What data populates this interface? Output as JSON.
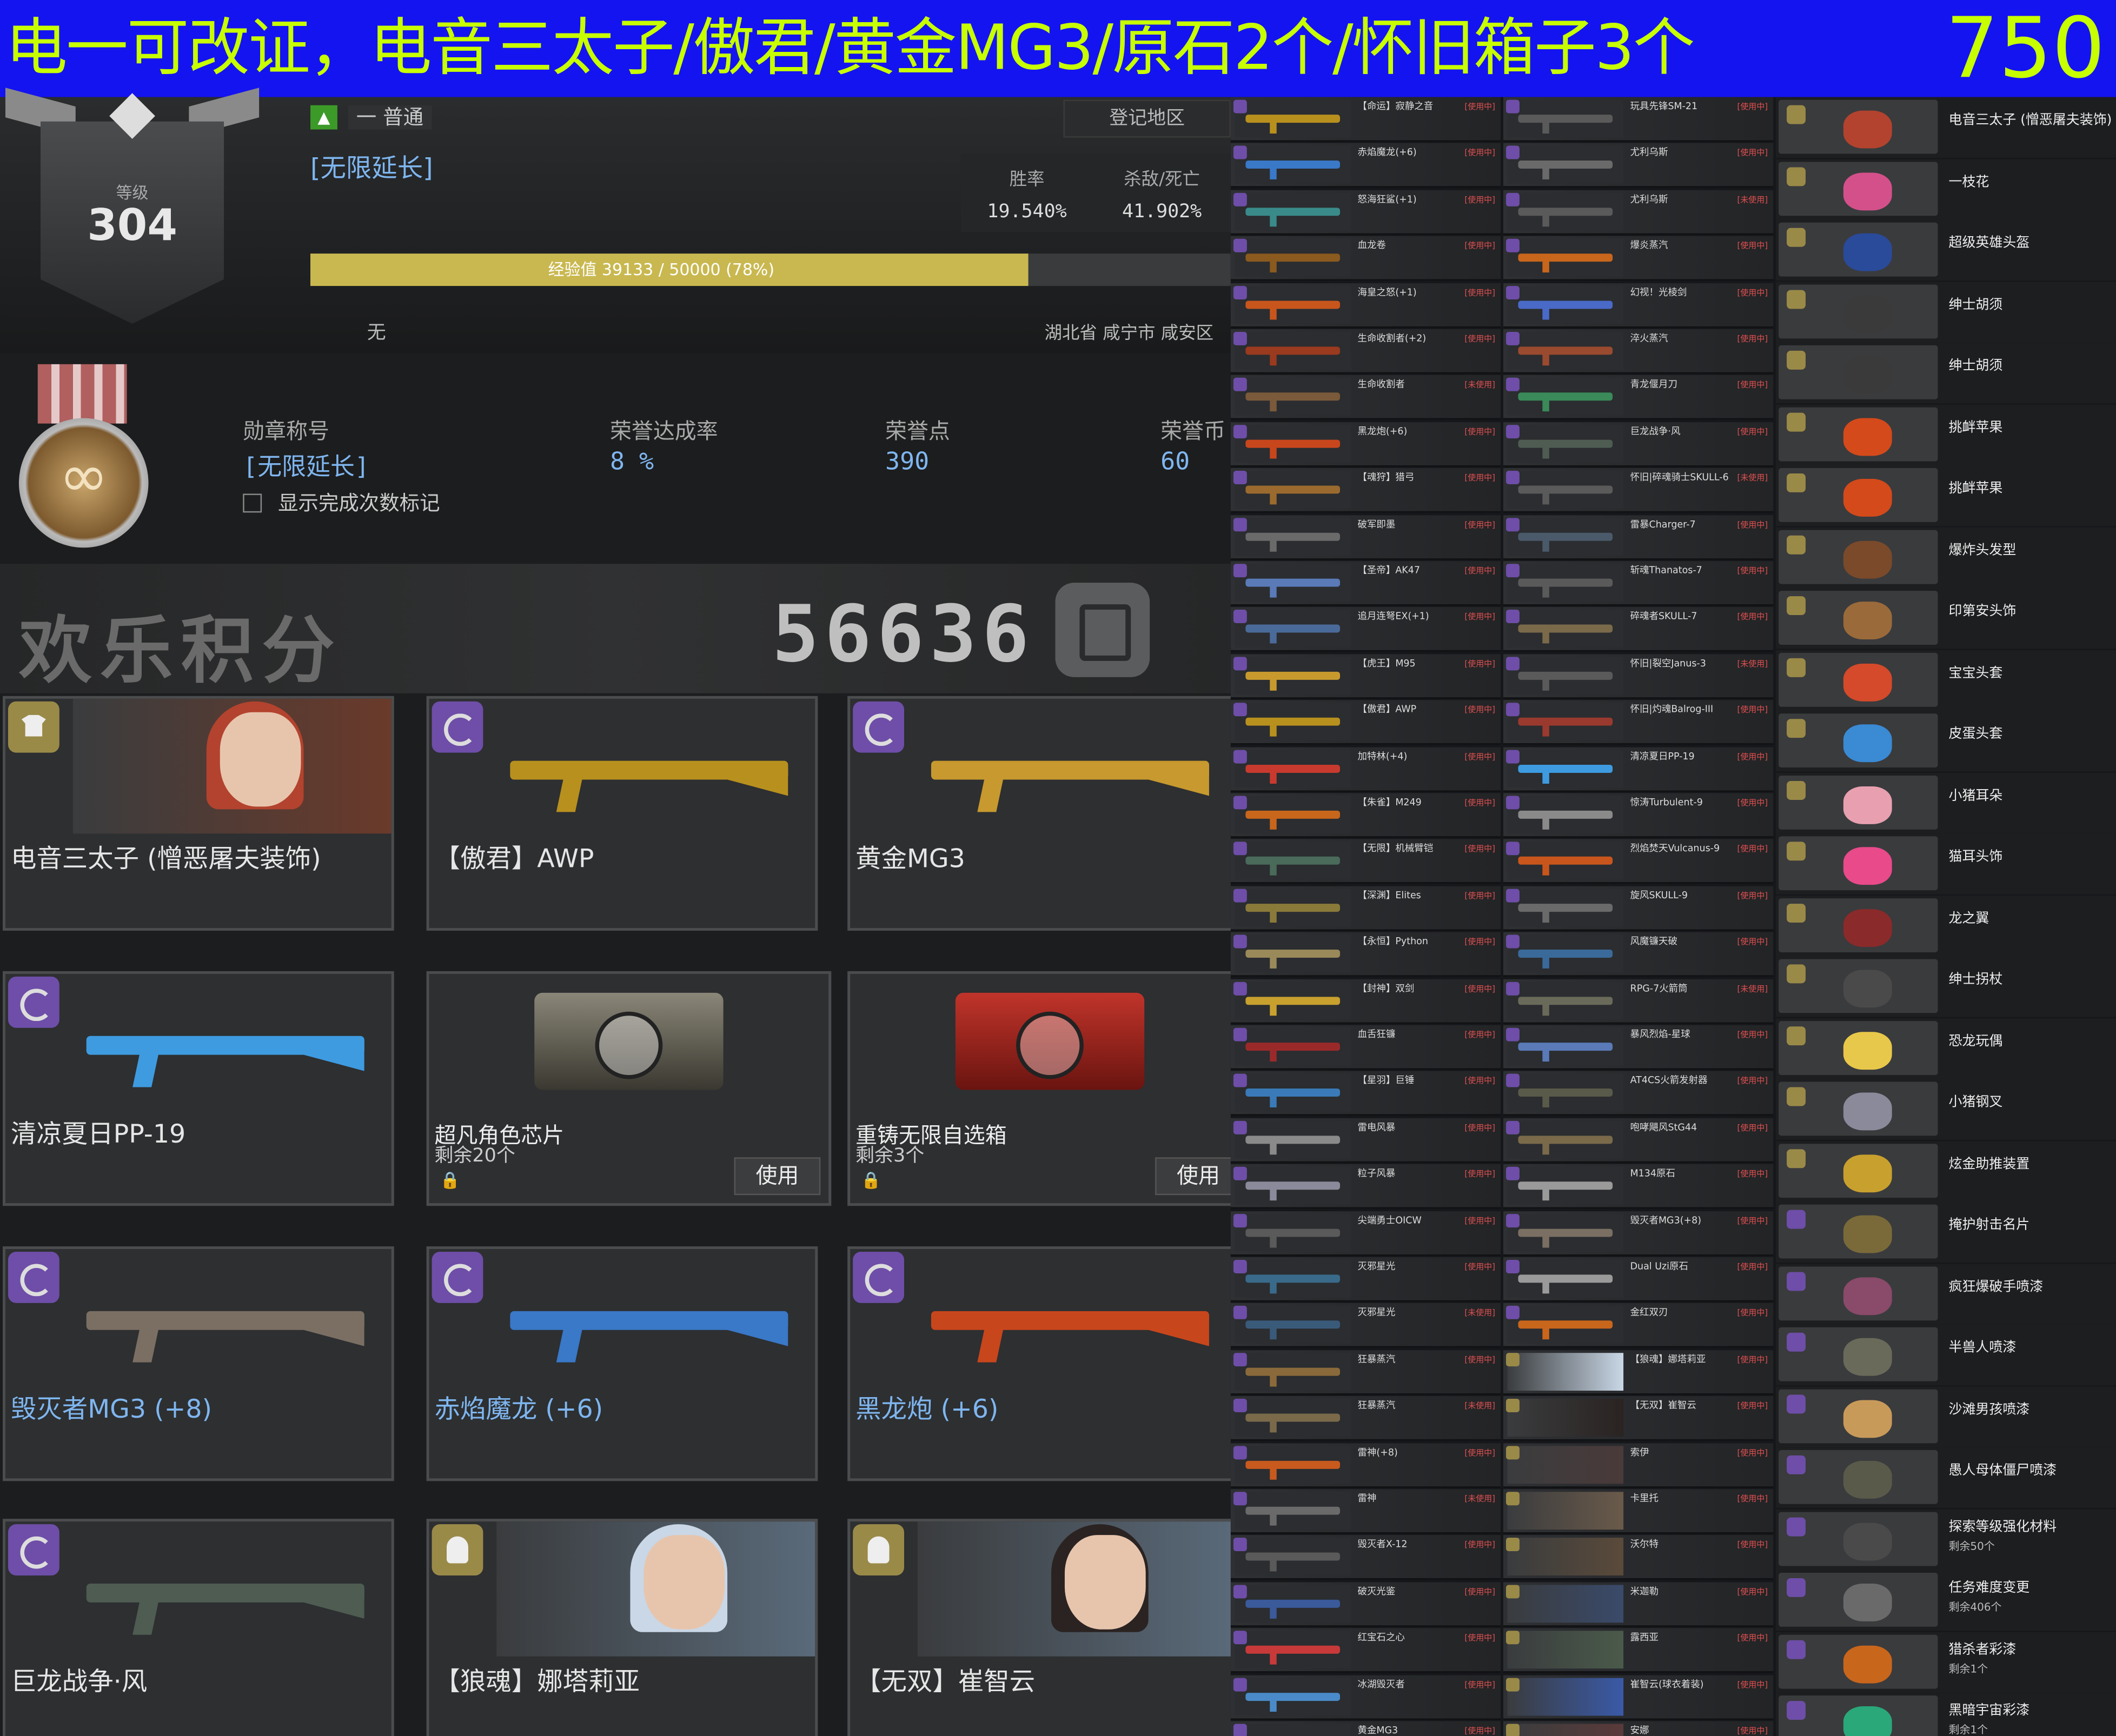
{
  "banner": {
    "title": "电一可改证，电音三太子/傲君/黄金MG3/原石2个/怀旧箱子3个",
    "price": "750"
  },
  "profile": {
    "level_label": "等级",
    "level": "304",
    "rank": "一 普通",
    "region_button": "登记地区",
    "title": "[无限延长]",
    "win_rate_label": "胜率",
    "win_rate": "19.540%",
    "kd_label": "杀敌/死亡",
    "kd": "41.902%",
    "xp_text": "经验值 39133 / 50000 (78%)",
    "xp_percent": 78,
    "clan": "无",
    "location": "湖北省 咸宁市 咸安区"
  },
  "medal": {
    "title_label": "勋章称号",
    "title_value": "[无限延长]",
    "honor_rate_label": "荣誉达成率",
    "honor_rate": "8 %",
    "honor_points_label": "荣誉点",
    "honor_points": "390",
    "honor_coins_label": "荣誉币",
    "honor_coins": "60",
    "show_count_label": "显示完成次数标记"
  },
  "score": {
    "label": "欢乐积分",
    "value": "56636"
  },
  "featured": [
    {
      "name": "电音三太子 (憎恶屠夫装饰)",
      "type": "cosmetic",
      "color": "#b3432e"
    },
    {
      "name": "【傲君】AWP",
      "type": "weapon",
      "color": "#b8901e"
    },
    {
      "name": "黄金MG3",
      "type": "weapon",
      "color": "#c7992e"
    },
    {
      "name": "清凉夏日PP-19",
      "type": "weapon",
      "color": "#3e9be0"
    },
    {
      "name": "超凡角色芯片",
      "sub": "剩余20个",
      "button": "使用",
      "type": "chip",
      "color": "#6e6a5c"
    },
    {
      "name": "重铸无限自选箱",
      "sub": "剩余3个",
      "button": "使用",
      "type": "box",
      "color": "#8e1c16"
    },
    {
      "name": "毁灭者MG3 (+8)",
      "type": "weapon",
      "color": "#7b6f63"
    },
    {
      "name": "赤焰魔龙 (+6)",
      "type": "weapon",
      "color": "#3a78c8"
    },
    {
      "name": "黑龙炮 (+6)",
      "type": "weapon",
      "color": "#c8461c"
    },
    {
      "name": "巨龙战争·风",
      "type": "weapon",
      "color": "#4e5c52"
    },
    {
      "name": "【狼魂】娜塔莉亚",
      "type": "character",
      "color": "#c9d7e6"
    },
    {
      "name": "【无双】崔智云",
      "type": "character",
      "color": "#2a2322"
    }
  ],
  "inventory_col1": [
    {
      "name": "【命运】寂静之音",
      "status": "[使用中]",
      "color": "#b8901e"
    },
    {
      "name": "赤焰魔龙(+6)",
      "status": "[使用中]",
      "color": "#3a78c8"
    },
    {
      "name": "怒海狂鲨(+1)",
      "status": "[使用中]",
      "color": "#3a8a8a"
    },
    {
      "name": "血龙卷",
      "status": "[使用中]",
      "color": "#8a5a1e"
    },
    {
      "name": "海皇之怒(+1)",
      "status": "[使用中]",
      "color": "#c8561c"
    },
    {
      "name": "生命收割者(+2)",
      "status": "[使用中]",
      "color": "#9a3a1e"
    },
    {
      "name": "生命收割者",
      "status": "[未使用]",
      "color": "#7a5a3a"
    },
    {
      "name": "黑龙炮(+6)",
      "status": "[使用中]",
      "color": "#c8461c"
    },
    {
      "name": "【魂狩】猎弓",
      "status": "[使用中]",
      "color": "#9a6a2e"
    },
    {
      "name": "破军即墨",
      "status": "[使用中]",
      "color": "#6a6a6a"
    },
    {
      "name": "【圣帝】AK47",
      "status": "[使用中]",
      "color": "#5a7ab8"
    },
    {
      "name": "追月连弩EX(+1)",
      "status": "[使用中]",
      "color": "#4a6a9a"
    },
    {
      "name": "【虎王】M95",
      "status": "[使用中]",
      "color": "#c89a2e"
    },
    {
      "name": "【傲君】AWP",
      "status": "[使用中]",
      "color": "#b8901e"
    },
    {
      "name": "加特林(+4)",
      "status": "[使用中]",
      "color": "#c83a2e"
    },
    {
      "name": "【朱雀】M249",
      "status": "[使用中]",
      "color": "#c8661c"
    },
    {
      "name": "【无限】机械臂铠",
      "status": "[使用中]",
      "color": "#4a6a5a"
    },
    {
      "name": "【深渊】Elites",
      "status": "[使用中]",
      "color": "#8a7a3a"
    },
    {
      "name": "【永恒】Python",
      "status": "[使用中]",
      "color": "#9a8a5a"
    },
    {
      "name": "【封神】双剑",
      "status": "[使用中]",
      "color": "#c8a02e"
    },
    {
      "name": "血舌狂镰",
      "status": "[使用中]",
      "color": "#9a2a2a"
    },
    {
      "name": "【星羽】巨锤",
      "status": "[使用中]",
      "color": "#3a7ab8"
    },
    {
      "name": "雷电风暴",
      "status": "[使用中]",
      "color": "#8a8a8a"
    },
    {
      "name": "粒子风暴",
      "status": "[使用中]",
      "color": "#8a8a9a"
    },
    {
      "name": "尖端勇士OICW",
      "status": "[使用中]",
      "color": "#5a5a5a"
    },
    {
      "name": "灭邪星光",
      "status": "[使用中]",
      "color": "#3a6a8a"
    },
    {
      "name": "灭邪星光",
      "status": "[未使用]",
      "color": "#3a5a7a"
    },
    {
      "name": "狂暴蒸汽",
      "status": "[使用中]",
      "color": "#8a6a3a"
    },
    {
      "name": "狂暴蒸汽",
      "status": "[未使用]",
      "color": "#7a6a4a"
    },
    {
      "name": "雷神(+8)",
      "status": "[使用中]",
      "color": "#c85a1e"
    },
    {
      "name": "雷神",
      "status": "[未使用]",
      "color": "#6a6a6a"
    },
    {
      "name": "毁灭者X-12",
      "status": "[使用中]",
      "color": "#5a5a5a"
    },
    {
      "name": "破灭光鉴",
      "status": "[使用中]",
      "color": "#3a5a9a"
    },
    {
      "name": "红宝石之心",
      "status": "[使用中]",
      "color": "#c83a3a"
    },
    {
      "name": "冰湖毁灭者",
      "status": "[使用中]",
      "color": "#4a8ac8"
    },
    {
      "name": "黄金MG3",
      "status": "[使用中]",
      "color": "#c7992e"
    }
  ],
  "inventory_col2": [
    {
      "name": "玩具先锋SM-21",
      "status": "[使用中]",
      "color": "#5a5a5a"
    },
    {
      "name": "尤利乌斯",
      "status": "[使用中]",
      "color": "#6a6a6a"
    },
    {
      "name": "尤利乌斯",
      "status": "[未使用]",
      "color": "#5a5a5a"
    },
    {
      "name": "爆炎蒸汽",
      "status": "[使用中]",
      "color": "#c8661c"
    },
    {
      "name": "幻视！光棱剑",
      "status": "[使用中]",
      "color": "#4a6ac8"
    },
    {
      "name": "淬火蒸汽",
      "status": "[使用中]",
      "color": "#9a4a2e"
    },
    {
      "name": "青龙偃月刀",
      "status": "[使用中]",
      "color": "#3a8a5a"
    },
    {
      "name": "巨龙战争·风",
      "status": "[使用中]",
      "color": "#4e5c52"
    },
    {
      "name": "怀旧|碎魂骑士SKULL-6",
      "status": "[未使用]",
      "color": "#5a5a5a"
    },
    {
      "name": "雷暴Charger-7",
      "status": "[使用中]",
      "color": "#4a5a6a"
    },
    {
      "name": "斩魂Thanatos-7",
      "status": "[使用中]",
      "color": "#5a5a5a"
    },
    {
      "name": "碎魂者SKULL-7",
      "status": "[使用中]",
      "color": "#7a6a4a"
    },
    {
      "name": "怀旧|裂空Janus-3",
      "status": "[未使用]",
      "color": "#5a5a5a"
    },
    {
      "name": "怀旧|灼魂Balrog-III",
      "status": "[使用中]",
      "color": "#9a3a2e"
    },
    {
      "name": "清凉夏日PP-19",
      "status": "[使用中]",
      "color": "#3e9be0"
    },
    {
      "name": "惊涛Turbulent-9",
      "status": "[使用中]",
      "color": "#8a8a8a"
    },
    {
      "name": "烈焰焚天Vulcanus-9",
      "status": "[使用中]",
      "color": "#c8561c"
    },
    {
      "name": "旋风SKULL-9",
      "status": "[使用中]",
      "color": "#6a6a6a"
    },
    {
      "name": "风魔镰天破",
      "status": "[使用中]",
      "color": "#3a6a9a"
    },
    {
      "name": "RPG-7火箭筒",
      "status": "[未使用]",
      "color": "#6a6a5a"
    },
    {
      "name": "暴风烈焰-星球",
      "status": "[使用中]",
      "color": "#5a7ab8"
    },
    {
      "name": "AT4CS火箭发射器",
      "status": "[使用中]",
      "color": "#5a5a4a"
    },
    {
      "name": "咆哮飓风StG44",
      "status": "[使用中]",
      "color": "#7a6a4a"
    },
    {
      "name": "M134原石",
      "status": "[使用中]",
      "color": "#9a9a9a"
    },
    {
      "name": "毁灭者MG3(+8)",
      "status": "[使用中]",
      "color": "#7b6f63"
    },
    {
      "name": "Dual Uzi原石",
      "status": "[使用中]",
      "color": "#9a9a9a"
    },
    {
      "name": "金红双刃",
      "status": "[使用中]",
      "color": "#c8661c"
    },
    {
      "name": "【狼魂】娜塔莉亚",
      "status": "[使用中]",
      "color": "#c9d7e6",
      "char": true
    },
    {
      "name": "【无双】崔智云",
      "status": "[使用中]",
      "color": "#2a2322",
      "char": true
    },
    {
      "name": "索伊",
      "status": "[使用中]",
      "color": "#4a3a3a",
      "char": true
    },
    {
      "name": "卡里托",
      "status": "[使用中]",
      "color": "#6a5a4a",
      "char": true
    },
    {
      "name": "沃尔特",
      "status": "[使用中]",
      "color": "#5a4a3a",
      "char": true
    },
    {
      "name": "米迦勒",
      "status": "[使用中]",
      "color": "#3a4a6a",
      "char": true
    },
    {
      "name": "露西亚",
      "status": "[使用中]",
      "color": "#4a5a4a",
      "char": true
    },
    {
      "name": "崔智云(球衣着装)",
      "status": "[使用中]",
      "color": "#3a5aa8",
      "char": true
    },
    {
      "name": "安娜",
      "status": "[使用中]",
      "color": "#5a3a3a",
      "char": true
    }
  ],
  "inventory_col3": [
    {
      "name": "电音三太子 (憎恶屠夫装饰)",
      "color": "#b3432e"
    },
    {
      "name": "一枝花",
      "color": "#d4508a"
    },
    {
      "name": "超级英雄头盔",
      "color": "#2a4a9a"
    },
    {
      "name": "绅士胡须",
      "color": "#3a3a3a"
    },
    {
      "name": "绅士胡须",
      "color": "#3a3a3a"
    },
    {
      "name": "挑衅苹果",
      "color": "#d44a1a"
    },
    {
      "name": "挑衅苹果",
      "color": "#d44a1a"
    },
    {
      "name": "爆炸头发型",
      "color": "#7a4a2a"
    },
    {
      "name": "印第安头饰",
      "color": "#9a6a3a"
    },
    {
      "name": "宝宝头套",
      "color": "#d44a2a"
    },
    {
      "name": "皮蛋头套",
      "color": "#3a8ad4"
    },
    {
      "name": "小猪耳朵",
      "color": "#e8a0b0"
    },
    {
      "name": "猫耳头饰",
      "color": "#e84a8a"
    },
    {
      "name": "龙之翼",
      "color": "#8a2a2a"
    },
    {
      "name": "绅士拐杖",
      "color": "#4a4a4a"
    },
    {
      "name": "恐龙玩偶",
      "color": "#e8c84a"
    },
    {
      "name": "小猪钢叉",
      "color": "#8a8a9a"
    },
    {
      "name": "炫金助推装置",
      "color": "#c8a02e"
    },
    {
      "name": "掩护射击名片",
      "color": "#7a6a3a",
      "spray": true
    },
    {
      "name": "疯狂爆破手喷漆",
      "color": "#8a4a6a",
      "spray": true
    },
    {
      "name": "半兽人喷漆",
      "color": "#6a6a5a",
      "spray": true
    },
    {
      "name": "沙滩男孩喷漆",
      "color": "#c89a5a",
      "spray": true
    },
    {
      "name": "愚人母体僵尸喷漆",
      "color": "#5a5a4a",
      "spray": true
    },
    {
      "name": "探索等级强化材料",
      "sub": "剩余50个",
      "color": "#4a4a4a",
      "spray": true
    },
    {
      "name": "任务难度变更",
      "sub": "剩余406个",
      "color": "#6a6a6a",
      "spray": true
    },
    {
      "name": "猎杀者彩漆",
      "sub": "剩余1个",
      "color": "#c8661c",
      "spray": true
    },
    {
      "name": "黑暗宇宙彩漆",
      "sub": "剩余1个",
      "color": "#2aa87a",
      "spray": true
    }
  ]
}
